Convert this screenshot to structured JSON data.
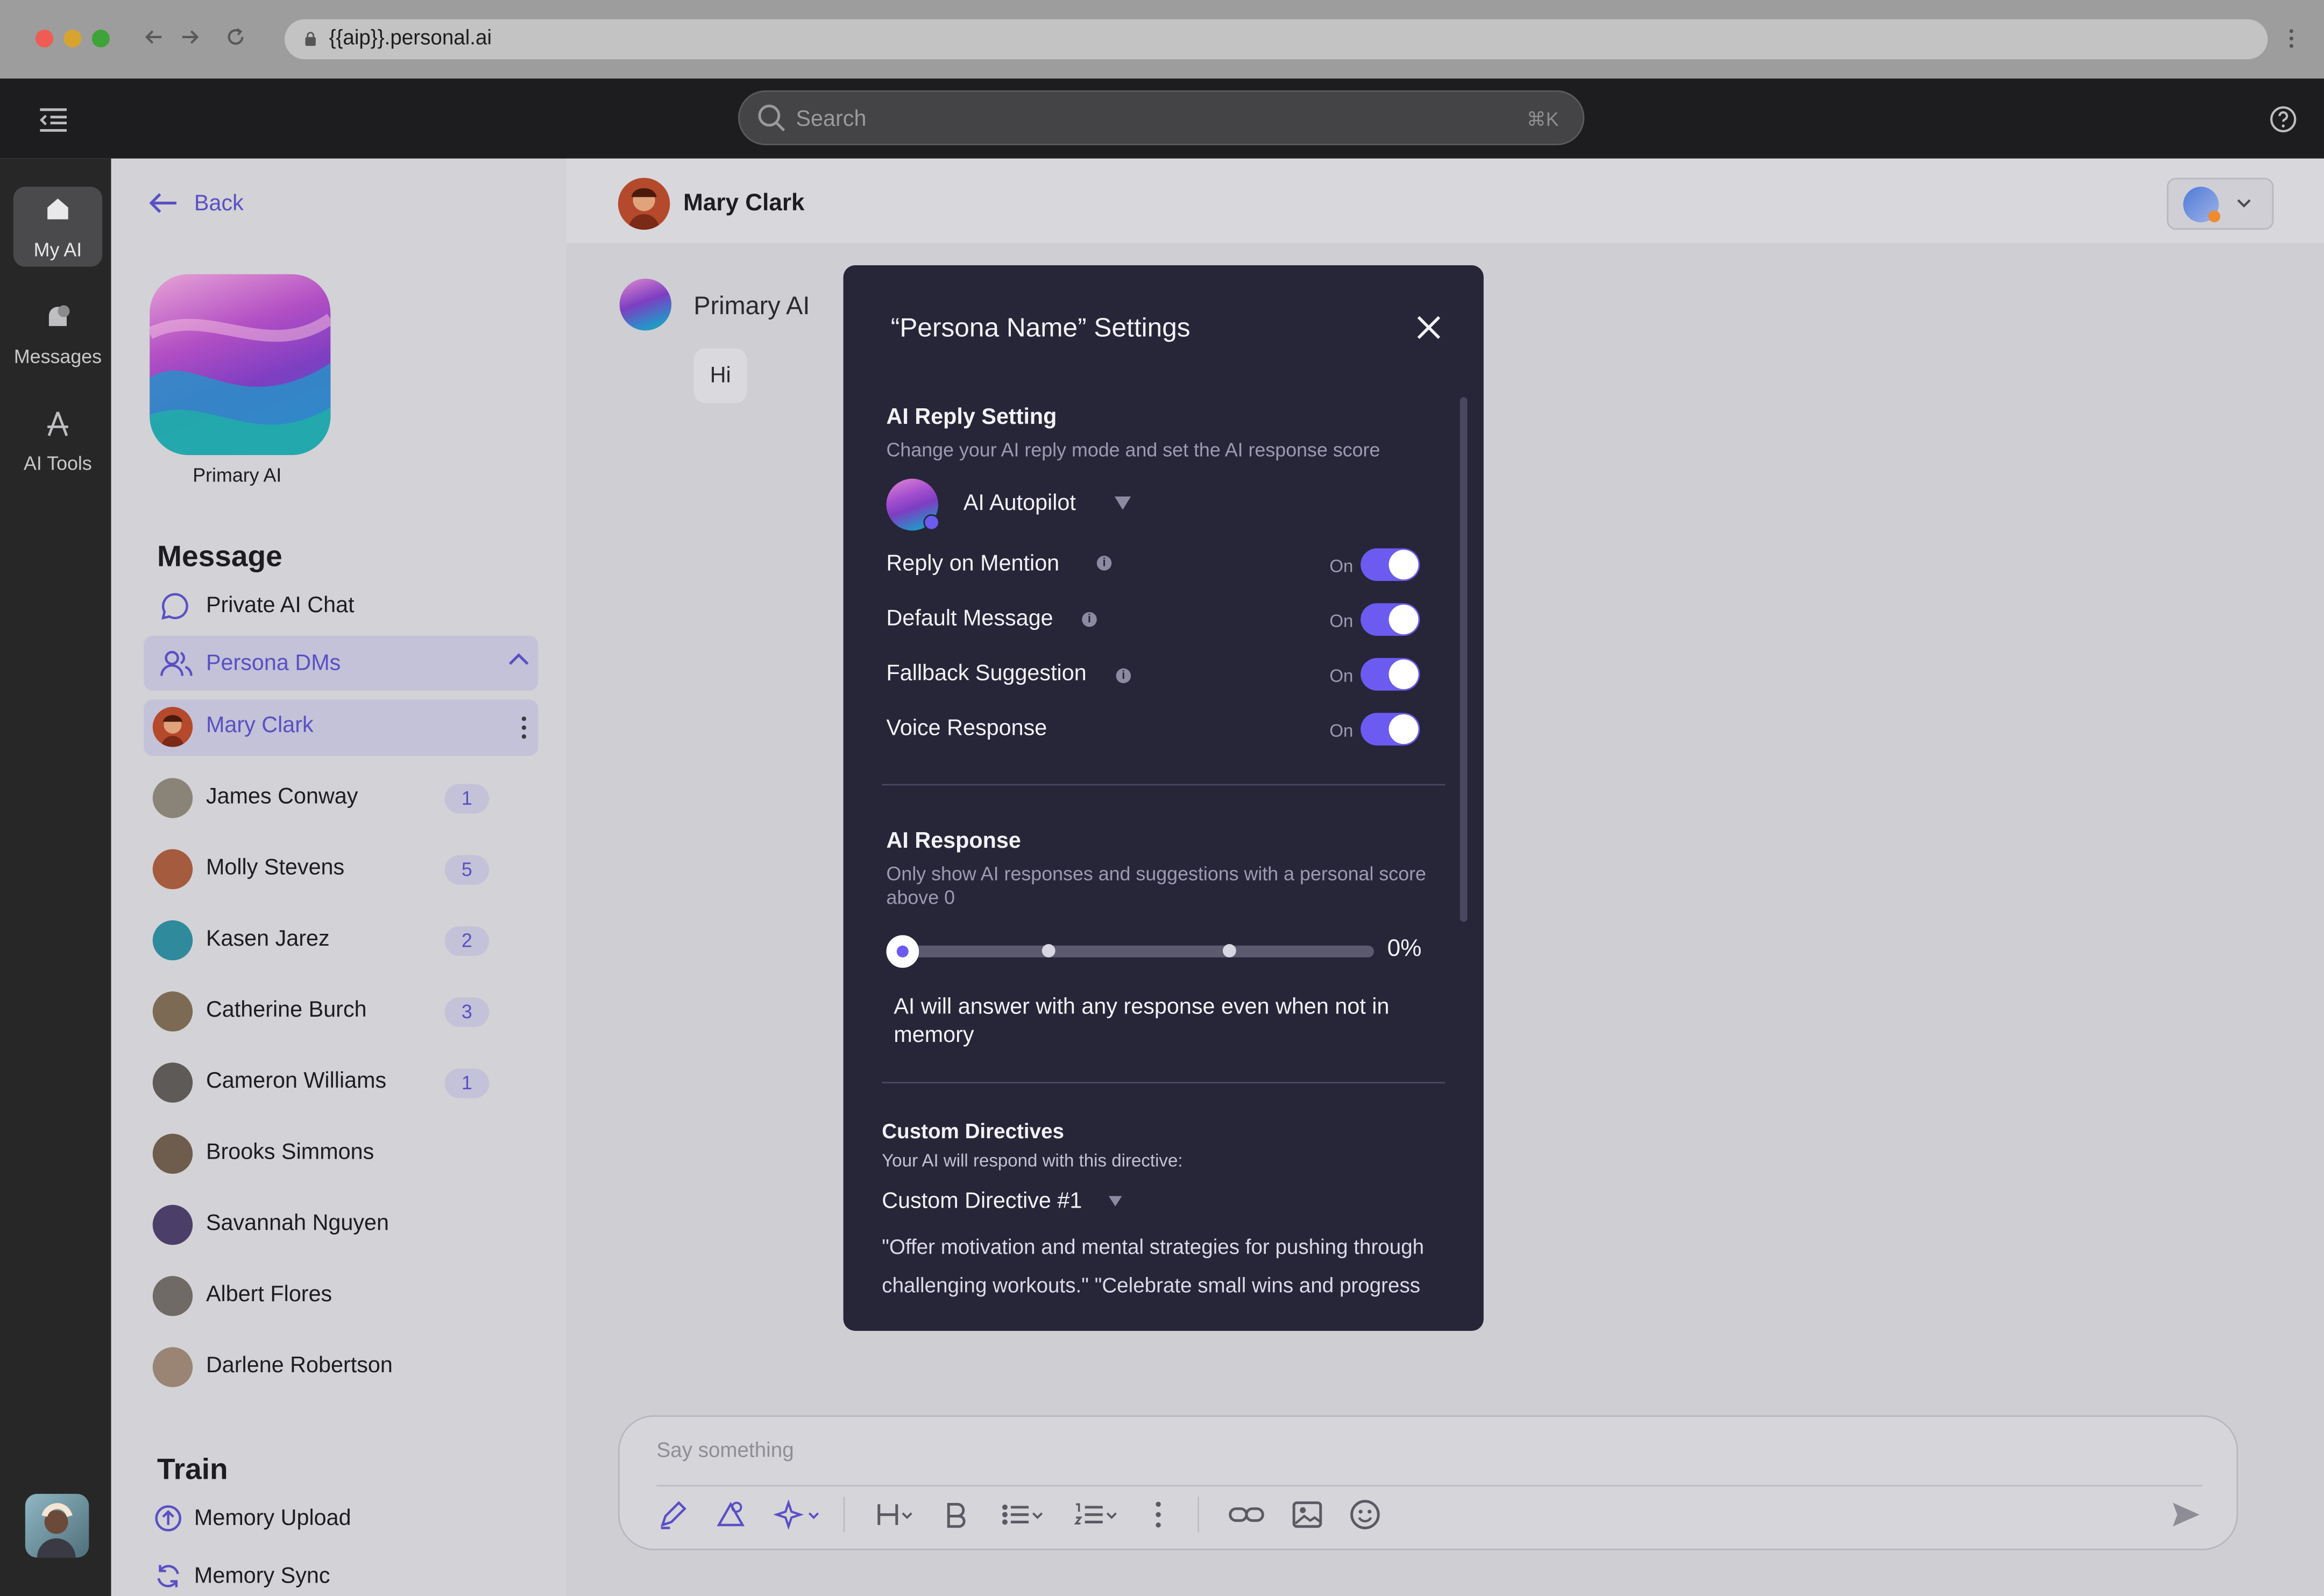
{
  "browser": {
    "url": "{{aip}}.personal.ai"
  },
  "header": {
    "search_placeholder": "Search",
    "search_shortcut": "⌘K"
  },
  "rail": {
    "items": [
      "My AI",
      "Messages",
      "AI Tools"
    ]
  },
  "sidebar": {
    "back_label": "Back",
    "profile_name": "Primary AI",
    "message_heading": "Message",
    "private_chat": "Private AI Chat",
    "persona_dms": "Persona DMs",
    "active_contact": "Mary Clark",
    "contacts": [
      {
        "name": "James Conway",
        "badge": "1"
      },
      {
        "name": "Molly Stevens",
        "badge": "5"
      },
      {
        "name": "Kasen Jarez",
        "badge": "2"
      },
      {
        "name": "Catherine Burch",
        "badge": "3"
      },
      {
        "name": "Cameron Williams",
        "badge": "1"
      },
      {
        "name": "Brooks Simmons",
        "badge": ""
      },
      {
        "name": "Savannah Nguyen",
        "badge": ""
      },
      {
        "name": "Albert Flores",
        "badge": ""
      },
      {
        "name": "Darlene Robertson",
        "badge": ""
      }
    ],
    "train_heading": "Train",
    "train_items": [
      "Memory Upload",
      "Memory Sync"
    ]
  },
  "chat": {
    "contact_name": "Mary Clark",
    "sender": "Primary AI",
    "message": "Hi",
    "composer_placeholder": "Say something"
  },
  "modal": {
    "title": "“Persona Name” Settings",
    "reply_setting": {
      "heading": "AI Reply Setting",
      "description": "Change your AI reply mode and set the AI response score",
      "mode": "AI Autopilot",
      "toggles": [
        {
          "label": "Reply on Mention",
          "state": "On",
          "info": true
        },
        {
          "label": "Default Message",
          "state": "On",
          "info": true
        },
        {
          "label": "Fallback Suggestion",
          "state": "On",
          "info": true
        },
        {
          "label": "Voice Response",
          "state": "On",
          "info": false
        }
      ]
    },
    "response": {
      "heading": "AI Response",
      "description": "Only show AI responses and suggestions with a personal score above 0",
      "score_percent": 0,
      "score_label": "0%",
      "note": "AI will answer with any response even when not in memory"
    },
    "directives": {
      "heading": "Custom Directives",
      "description": "Your AI will respond with this directive:",
      "selected": "Custom Directive #1",
      "text": "\"Offer motivation and mental strategies for pushing through challenging workouts.\" \"Celebrate small wins and progress"
    }
  },
  "colors": {
    "accent": "#6b5bf0",
    "modal_bg": "#272538",
    "app_header": "#1d1d1f"
  }
}
